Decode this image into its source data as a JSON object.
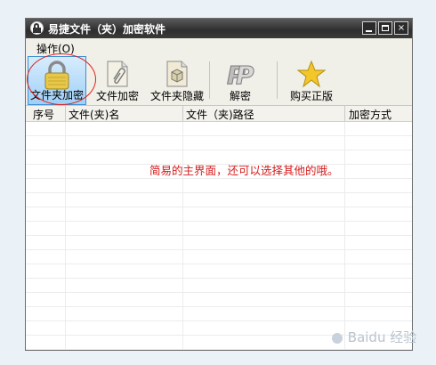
{
  "window": {
    "title": "易捷文件（夹）加密软件",
    "controls": {
      "minimize": "_",
      "maximize": "□",
      "close": "×"
    }
  },
  "menubar": {
    "items": [
      {
        "label": "操作(O)"
      }
    ]
  },
  "toolbar": {
    "buttons": [
      {
        "label": "文件夹加密",
        "icon": "padlock-icon",
        "active": true
      },
      {
        "label": "文件加密",
        "icon": "paperclip-document-icon"
      },
      {
        "label": "文件夹隐藏",
        "icon": "box-document-icon"
      },
      {
        "label": "解密",
        "icon": "p-logo-icon"
      },
      {
        "label": "购买正版",
        "icon": "star-icon"
      }
    ]
  },
  "table": {
    "columns": [
      "序号",
      "文件(夹)名",
      "文件（夹)路径",
      "加密方式"
    ],
    "rows": []
  },
  "annotation": {
    "text": "简易的主界面，还可以选择其他的哦。",
    "color": "#d41c1c"
  },
  "watermark": {
    "text": "Baidu 经验"
  },
  "colors": {
    "titlebar": "#3a3a3a",
    "active_tool": "#9fd0f7",
    "annotation_circle": "#e2231a"
  }
}
